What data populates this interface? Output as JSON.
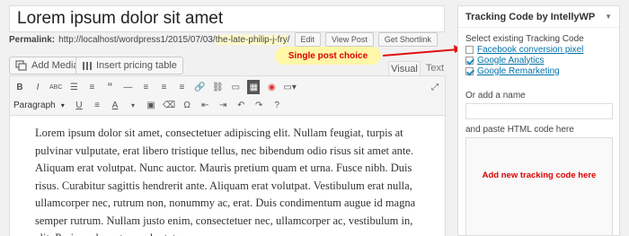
{
  "post": {
    "title": "Lorem ipsum dolor sit amet",
    "permalink_label": "Permalink:",
    "permalink_base": "http://localhost/wordpress1/2015/07/03/",
    "permalink_slug": "the-late-philip-j-fry",
    "permalink_end": "/",
    "edit_label": "Edit",
    "view_label": "View Post",
    "shortlink_label": "Get Shortlink"
  },
  "media": {
    "add_media_label": "Add Media",
    "pricing_label": "Insert pricing table"
  },
  "annotation": {
    "callout_text": "Single post choice",
    "code_hint": "Add new tracking code here"
  },
  "editor": {
    "tab_visual": "Visual",
    "tab_text": "Text",
    "format_value": "Paragraph",
    "content": "Lorem ipsum dolor sit amet, consectetuer adipiscing elit. Nullam feugiat, turpis at pulvinar vulputate, erat libero tristique tellus, nec bibendum odio risus sit amet ante. Aliquam erat volutpat. Nunc auctor. Mauris pretium quam et urna. Fusce nibh. Duis risus. Curabitur sagittis hendrerit ante. Aliquam erat volutpat. Vestibulum erat nulla, ullamcorper nec, rutrum non, nonummy ac, erat. Duis condimentum augue id magna semper rutrum. Nullam justo enim, consectetuer nec, ullamcorper ac, vestibulum in, elit. Proin pede metus, vulputate nec"
  },
  "tracking": {
    "panel_title": "Tracking Code by IntellyWP",
    "existing_label": "Select existing Tracking Code",
    "codes": [
      {
        "label": "Facebook conversion pixel",
        "checked": false
      },
      {
        "label": "Google Analytics",
        "checked": true
      },
      {
        "label": "Google Remarketing",
        "checked": true
      }
    ],
    "name_label": "Or add a name",
    "paste_label": "and paste HTML code here"
  }
}
